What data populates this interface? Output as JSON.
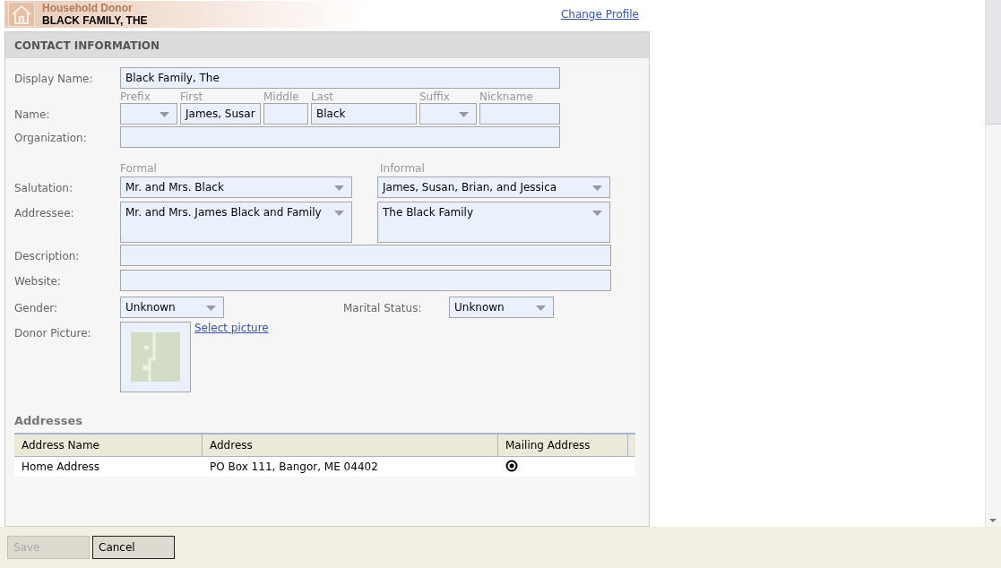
{
  "header": {
    "role": "Household Donor",
    "name": "BLACK FAMILY, THE",
    "link": "Change Profile"
  },
  "section": {
    "title": "CONTACT INFORMATION"
  },
  "display_name": {
    "label": "Display Name:",
    "value": "Black Family, The"
  },
  "name": {
    "label": "Name:",
    "parts": [
      {
        "caption": "Prefix",
        "kind": "select"
      },
      {
        "caption": "First",
        "kind": "text",
        "value": "James, Susar"
      },
      {
        "caption": "Middle",
        "kind": "text"
      },
      {
        "caption": "Last",
        "kind": "text",
        "value": "Black"
      },
      {
        "caption": "Suffix",
        "kind": "select"
      },
      {
        "caption": "Nickname",
        "kind": "text"
      }
    ]
  },
  "organization": {
    "label": "Organization:"
  },
  "salutation_captions": [
    "Formal",
    "Informal"
  ],
  "salutation": {
    "label": "Salutation:",
    "formal": "Mr. and Mrs. Black",
    "informal": "James, Susan, Brian, and Jessica"
  },
  "addressee": {
    "label": "Addressee:",
    "formal": "Mr. and Mrs. James Black and Family",
    "informal": "The Black Family"
  },
  "description": {
    "label": "Description:"
  },
  "website": {
    "label": "Website:"
  },
  "gender": {
    "label": "Gender:",
    "value": "Unknown"
  },
  "marital_status": {
    "label": "Marital Status:",
    "value": "Unknown"
  },
  "donor_picture": {
    "label": "Donor Picture:",
    "link": "Select picture"
  },
  "addresses": {
    "title": "Addresses",
    "columns": [
      "Address Name",
      "Address",
      "Mailing Address"
    ],
    "rows": [
      {
        "name": "Home Address",
        "address": "PO Box 111, Bangor, ME 04402",
        "selected": true
      }
    ]
  },
  "buttons": [
    {
      "label": "Save",
      "disabled": true
    },
    {
      "label": "Cancel",
      "disabled": false
    }
  ]
}
